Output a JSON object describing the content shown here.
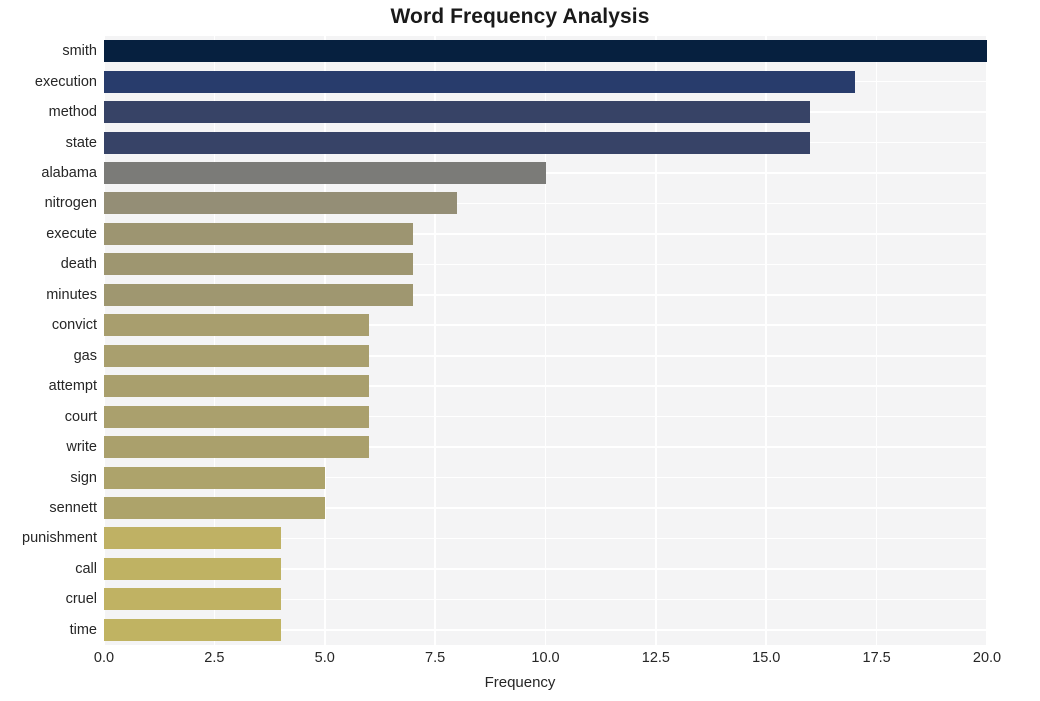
{
  "chart_data": {
    "type": "bar",
    "orientation": "horizontal",
    "title": "Word Frequency Analysis",
    "xlabel": "Frequency",
    "ylabel": "",
    "categories": [
      "smith",
      "execution",
      "method",
      "state",
      "alabama",
      "nitrogen",
      "execute",
      "death",
      "minutes",
      "convict",
      "gas",
      "attempt",
      "court",
      "write",
      "sign",
      "sennett",
      "punishment",
      "call",
      "cruel",
      "time"
    ],
    "values": [
      20,
      17,
      16,
      16,
      10,
      8,
      7,
      7,
      7,
      6,
      6,
      6,
      6,
      6,
      5,
      5,
      4,
      4,
      4,
      4
    ],
    "bar_colors": [
      "#06203f",
      "#283c6c",
      "#374366",
      "#374367",
      "#7b7b78",
      "#948e76",
      "#9d9571",
      "#9e9670",
      "#9f9770",
      "#a89e6e",
      "#a99f6e",
      "#a99f6d",
      "#aaa06d",
      "#aaa06c",
      "#ada36b",
      "#ada36a",
      "#bfb164",
      "#bfb263",
      "#c0b263",
      "#c0b362"
    ],
    "xlim": [
      0,
      20
    ],
    "xticks": [
      "0.0",
      "2.5",
      "5.0",
      "7.5",
      "10.0",
      "12.5",
      "15.0",
      "17.5",
      "20.0"
    ],
    "xtick_values": [
      0,
      2.5,
      5,
      7.5,
      10,
      12.5,
      15,
      17.5,
      20
    ],
    "grid": true,
    "grid_color": "#ffffff",
    "plot_background": "#f4f4f5",
    "figure_background": "#ffffff",
    "legend": null,
    "text_color": "#262626",
    "title_color": "#1a1a1a"
  }
}
